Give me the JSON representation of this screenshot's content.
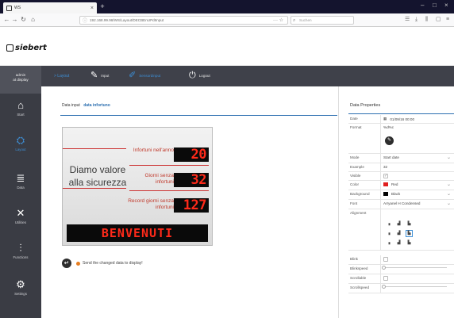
{
  "browser": {
    "tab_title": "WS",
    "tab_close": "×",
    "new_tab": "+",
    "win_min": "–",
    "win_max": "□",
    "win_close": "×",
    "url": "192.168.99.98/WS/Layout/DECBEnUPdIInput",
    "search_placeholder": "Suchen"
  },
  "logo": {
    "text": "siebert"
  },
  "sidebar": {
    "user_line1": "admin",
    "user_line2": "at display",
    "items": [
      {
        "label": "Start",
        "icon": "home-icon"
      },
      {
        "label": "Layout",
        "icon": "layout-icon"
      },
      {
        "label": "Data",
        "icon": "data-icon"
      },
      {
        "label": "Utilities",
        "icon": "utilities-icon"
      },
      {
        "label": "Functions",
        "icon": "functions-icon"
      },
      {
        "label": "Settings",
        "icon": "settings-icon"
      }
    ]
  },
  "toolbar": {
    "breadcrumb": "> Layout",
    "input": "Input",
    "layout_input": "Sensordinput",
    "logout": "Logout"
  },
  "main": {
    "subtab1": "Data input",
    "subtab2": "data infortuno",
    "send_label": "Send the changed data to display!"
  },
  "display": {
    "slogan": "Diamo valore alla sicurezza",
    "rows": [
      {
        "label": "Infortuni nell'anno",
        "value": "20"
      },
      {
        "label": "Giorni senza infortuni",
        "value": "32"
      },
      {
        "label": "Record giorni senza infortuni",
        "value": "127"
      }
    ],
    "banner": "BENVENUTI"
  },
  "props": {
    "title": "Data Properties",
    "date_label": "Date",
    "date_value": "01/09/16 00:00",
    "format_label": "Format",
    "format_value": "%d%c",
    "mode_label": "Mode",
    "mode_value": "Start date",
    "example_label": "Example",
    "example_value": "32",
    "visible_label": "Visible",
    "color_label": "Color",
    "color_value": "Red",
    "background_label": "Background",
    "background_value": "Black",
    "font_label": "Font",
    "font_value": "Arryanel H Condensed",
    "alignment_label": "Alignment",
    "blink_label": "Blink",
    "blinkspeed_label": "Blinkspeed",
    "scrollable_label": "Scrollable",
    "scrollspeed_label": "Scrollspeed"
  },
  "colors": {
    "accent": "#3d8fd6",
    "sidebar": "#3a3c44",
    "led": "#ff2a1a",
    "selected_color": "#e01e1e",
    "selected_background": "#000000"
  }
}
